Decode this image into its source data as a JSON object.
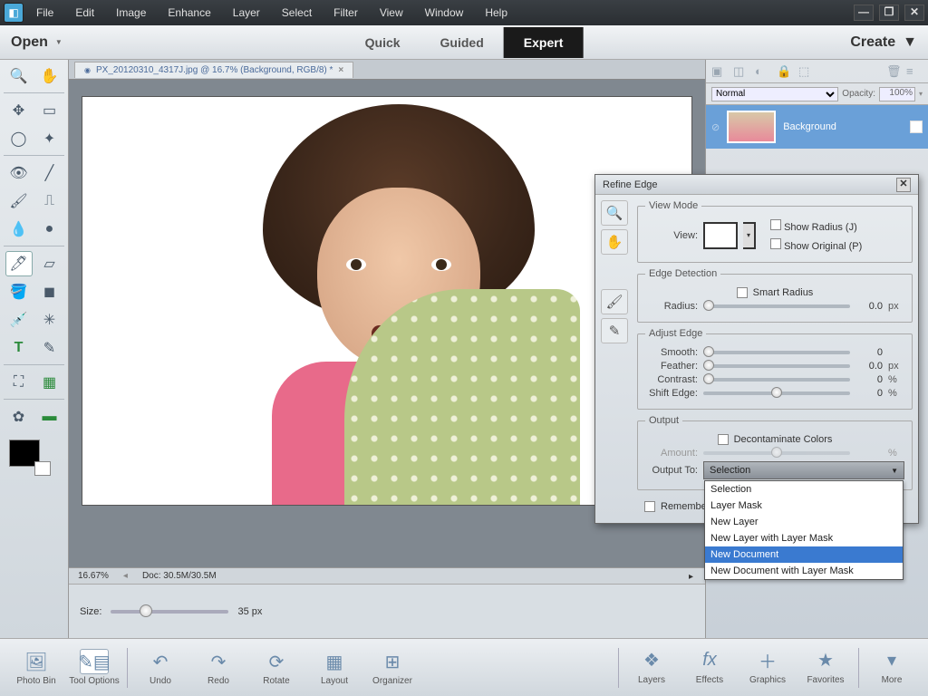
{
  "menu": {
    "items": [
      "File",
      "Edit",
      "Image",
      "Enhance",
      "Layer",
      "Select",
      "Filter",
      "View",
      "Window",
      "Help"
    ]
  },
  "modebar": {
    "open": "Open",
    "create": "Create",
    "tabs": [
      "Quick",
      "Guided",
      "Expert"
    ],
    "active": "Expert"
  },
  "doc": {
    "tab": "PX_20120310_4317J.jpg @ 16.7% (Background, RGB/8) *",
    "zoom": "16.67%",
    "docstat": "Doc: 30.5M/30.5M"
  },
  "options": {
    "size_label": "Size:",
    "size_value": "35 px"
  },
  "layers": {
    "blend": "Normal",
    "opacity_label": "Opacity:",
    "opacity_value": "100%",
    "layer_name": "Background"
  },
  "dialog": {
    "title": "Refine Edge",
    "view_mode": "View Mode",
    "view_label": "View:",
    "show_radius": "Show Radius (J)",
    "show_original": "Show Original (P)",
    "edge_detection": "Edge Detection",
    "smart_radius": "Smart Radius",
    "radius": "Radius:",
    "radius_val": "0.0",
    "px": "px",
    "adjust_edge": "Adjust Edge",
    "smooth": "Smooth:",
    "smooth_val": "0",
    "feather": "Feather:",
    "feather_val": "0.0",
    "contrast": "Contrast:",
    "contrast_val": "0",
    "pct": "%",
    "shift": "Shift Edge:",
    "shift_val": "0",
    "output": "Output",
    "decontaminate": "Decontaminate Colors",
    "amount": "Amount:",
    "output_to": "Output To:",
    "output_sel": "Selection",
    "options": [
      "Selection",
      "Layer Mask",
      "New Layer",
      "New Layer with Layer Mask",
      "New Document",
      "New Document with Layer Mask"
    ],
    "highlight": "New Document",
    "remember": "Remember"
  },
  "bottom": {
    "left": [
      "Photo Bin",
      "Tool Options",
      "Undo",
      "Redo",
      "Rotate",
      "Layout",
      "Organizer"
    ],
    "right": [
      "Layers",
      "Effects",
      "Graphics",
      "Favorites",
      "More"
    ]
  }
}
